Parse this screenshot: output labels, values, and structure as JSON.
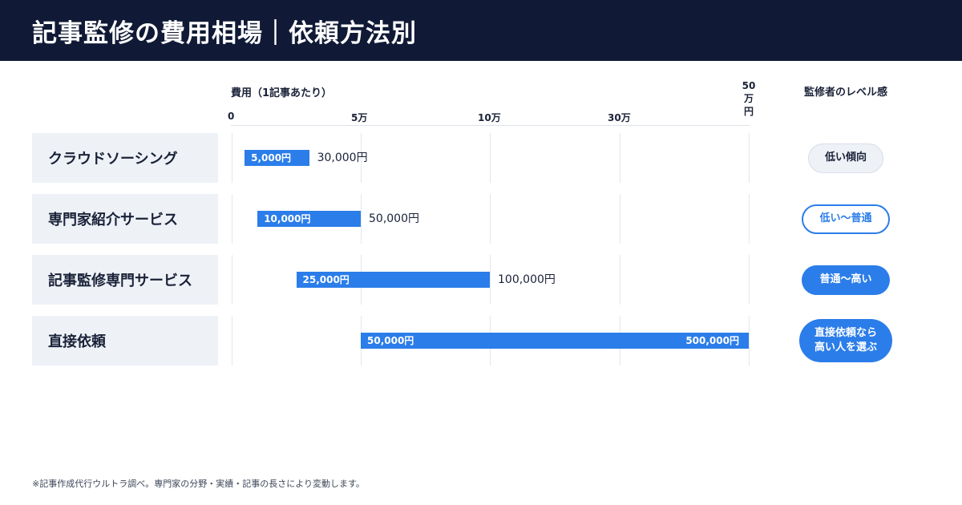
{
  "header": {
    "title": "記事監修の費用相場｜依頼方法別"
  },
  "chart_data": {
    "type": "bar",
    "orientation": "horizontal",
    "subtype": "range",
    "axis_label": "費用（1記事あたり）",
    "x_ticks": [
      {
        "label": "0",
        "value": 0
      },
      {
        "label": "5万",
        "value": 50000
      },
      {
        "label": "10万",
        "value": 100000
      },
      {
        "label": "30万",
        "value": 300000
      },
      {
        "label": "50\n万\n円",
        "value": 500000
      }
    ],
    "categories": [
      "クラウドソーシング",
      "専門家紹介サービス",
      "記事監修専門サービス",
      "直接依頼"
    ],
    "ranges": [
      {
        "min": 5000,
        "max": 30000,
        "min_label": "5,000円",
        "max_label": "30,000円"
      },
      {
        "min": 10000,
        "max": 50000,
        "min_label": "10,000円",
        "max_label": "50,000円"
      },
      {
        "min": 25000,
        "max": 100000,
        "min_label": "25,000円",
        "max_label": "100,000円"
      },
      {
        "min": 50000,
        "max": 500000,
        "min_label": "50,000円",
        "max_label": "500,000円"
      }
    ],
    "grid": true
  },
  "level": {
    "header": "監修者のレベル感",
    "badges": [
      {
        "label": "低い傾向",
        "style": "low"
      },
      {
        "label": "低い〜普通",
        "style": "outline"
      },
      {
        "label": "普通〜高い",
        "style": "filled"
      },
      {
        "label": "直接依頼なら\n高い人を選ぶ",
        "style": "filled"
      }
    ]
  },
  "colors": {
    "header_bg": "#101a36",
    "bar": "#2b7de9",
    "label_bg": "#eef2f7"
  },
  "footnote": "※記事作成代行ウルトラ調べ。専門家の分野・実績・記事の長さにより変動します。"
}
